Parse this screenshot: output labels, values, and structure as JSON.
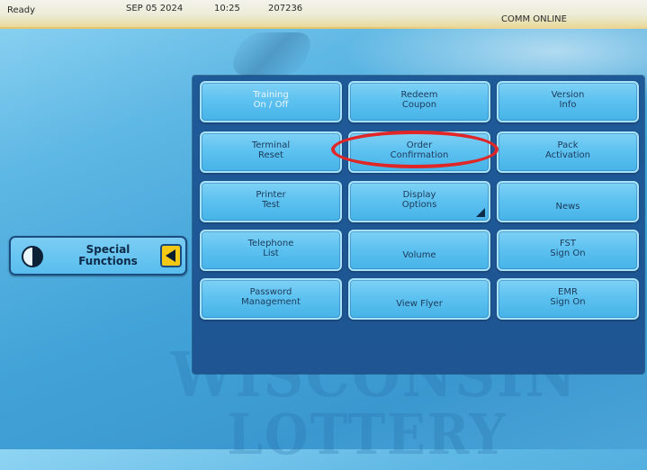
{
  "status_bar": {
    "ready": "Ready",
    "date": "SEP 05 2024",
    "time": "10:25",
    "terminal_id": "207236",
    "connection": "COMM ONLINE"
  },
  "watermark": {
    "line1": "WISCONSIN",
    "line2": "LOTTERY"
  },
  "special_functions": {
    "label": "Special\nFunctions"
  },
  "menu": {
    "buttons": [
      {
        "label": "Training\nOn / Off"
      },
      {
        "label": "Redeem\nCoupon"
      },
      {
        "label": "Version\nInfo"
      },
      {
        "label": "Terminal\nReset"
      },
      {
        "label": "Order\nConfirmation"
      },
      {
        "label": "Pack\nActivation"
      },
      {
        "label": "Printer\nTest"
      },
      {
        "label": "Display\nOptions"
      },
      {
        "label": "News"
      },
      {
        "label": "Telephone\nList"
      },
      {
        "label": "Volume"
      },
      {
        "label": "FST\nSign On"
      },
      {
        "label": "Password\nManagement"
      },
      {
        "label": "View Flyer"
      },
      {
        "label": "EMR\nSign On"
      }
    ]
  },
  "colors": {
    "highlight": "#e02626",
    "connection_text": "#c0392b",
    "accent_arrow": "#f4c915"
  }
}
